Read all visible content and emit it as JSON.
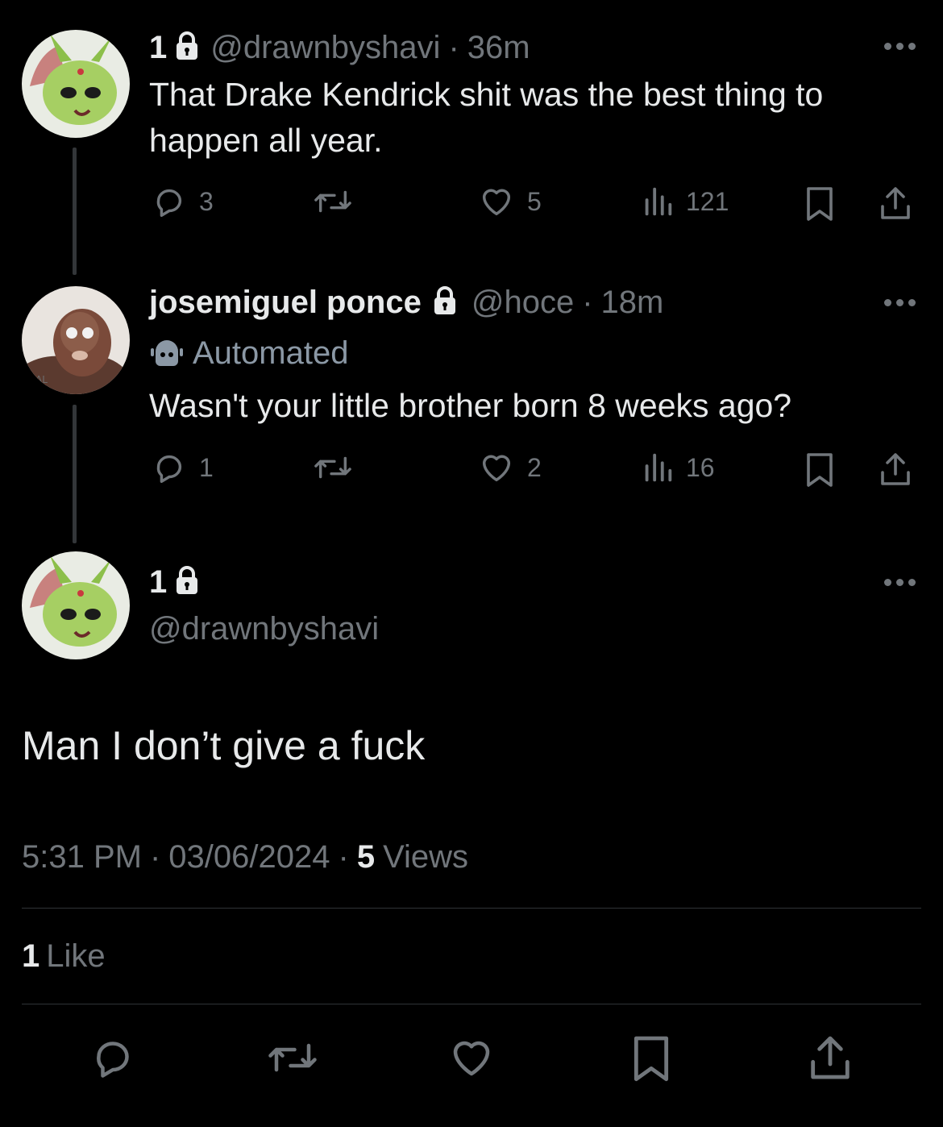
{
  "colors": {
    "background": "#000000",
    "text": "#e7e9ea",
    "muted": "#71767b",
    "line": "#2f3336"
  },
  "tweets": [
    {
      "display_name": "1",
      "handle": "@drawnbyshavi",
      "time": "36m",
      "text": "That Drake Kendrick shit was the best thing to happen all year.",
      "reply_count": "3",
      "like_count": "5",
      "view_count": "121"
    },
    {
      "display_name": "josemiguel ponce",
      "handle": "@hoce",
      "time": "18m",
      "label": "Automated",
      "text": "Wasn't your little brother born 8 weeks ago?",
      "reply_count": "1",
      "like_count": "2",
      "view_count": "16"
    }
  ],
  "main": {
    "display_name": "1",
    "handle": "@drawnbyshavi",
    "text": "Man I don’t give a fuck",
    "time": "5:31 PM",
    "date": "03/06/2024",
    "views_count": "5",
    "views_label": "Views",
    "likes_count": "1",
    "likes_label": "Like"
  },
  "icons": [
    "more-icon",
    "reply-icon",
    "retweet-icon",
    "like-icon",
    "views-icon",
    "bookmark-icon",
    "share-icon",
    "lock-icon",
    "bot-icon"
  ]
}
